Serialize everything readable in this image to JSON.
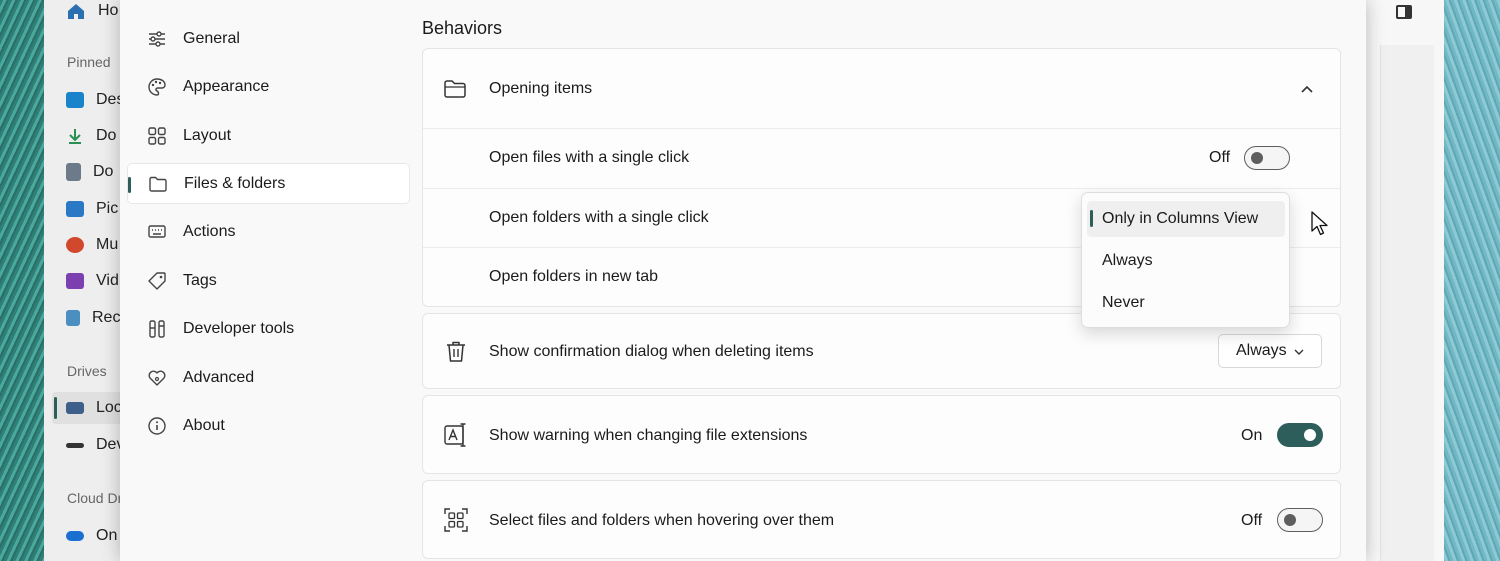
{
  "explorer": {
    "home_label": "Ho",
    "pinned_header": "Pinned",
    "pinned_items": [
      {
        "label": "Des",
        "icon": "desktop-icon",
        "color": "#1a83c9"
      },
      {
        "label": "Do",
        "icon": "download-icon",
        "color": "#2a8f52"
      },
      {
        "label": "Do",
        "icon": "documents-icon",
        "color": "#6d7a8a"
      },
      {
        "label": "Pic",
        "icon": "pictures-icon",
        "color": "#2b78c5"
      },
      {
        "label": "Mu",
        "icon": "music-icon",
        "color": "#d1482c"
      },
      {
        "label": "Vid",
        "icon": "videos-icon",
        "color": "#7b3fb0"
      },
      {
        "label": "Rec",
        "icon": "recycle-bin-icon",
        "color": "#4a8fc0"
      }
    ],
    "drives_header": "Drives",
    "drive_items": [
      {
        "label": "Loc",
        "icon": "local-disk-icon"
      },
      {
        "label": "Dev",
        "icon": "dev-drive-icon"
      }
    ],
    "cloud_header": "Cloud Dr",
    "cloud_items": [
      {
        "label": "On",
        "icon": "onedrive-icon"
      }
    ]
  },
  "settings": {
    "nav": [
      {
        "label": "General",
        "icon": "sliders-icon"
      },
      {
        "label": "Appearance",
        "icon": "palette-icon"
      },
      {
        "label": "Layout",
        "icon": "grid-icon"
      },
      {
        "label": "Files & folders",
        "icon": "folder-icon",
        "selected": true
      },
      {
        "label": "Actions",
        "icon": "keyboard-icon"
      },
      {
        "label": "Tags",
        "icon": "tag-icon"
      },
      {
        "label": "Developer tools",
        "icon": "tools-icon"
      },
      {
        "label": "Advanced",
        "icon": "heart-network-icon"
      },
      {
        "label": "About",
        "icon": "info-icon"
      }
    ],
    "section_title": "Behaviors",
    "opening_items": {
      "label": "Opening items",
      "rows": [
        {
          "label": "Open files with a single click",
          "toggle_text": "Off"
        },
        {
          "label": "Open folders with a single click"
        },
        {
          "label": "Open folders in new tab"
        }
      ]
    },
    "delete_confirm": {
      "label": "Show confirmation dialog when deleting items",
      "value": "Always"
    },
    "extension_warning": {
      "label": "Show warning when changing file extensions",
      "toggle_text": "On"
    },
    "hover_select": {
      "label": "Select files and folders when hovering over them",
      "toggle_text": "Off"
    },
    "popup": {
      "options": [
        "Only in Columns View",
        "Always",
        "Never"
      ],
      "selected": "Only in Columns View"
    },
    "accent_color": "#2e5e5b"
  }
}
